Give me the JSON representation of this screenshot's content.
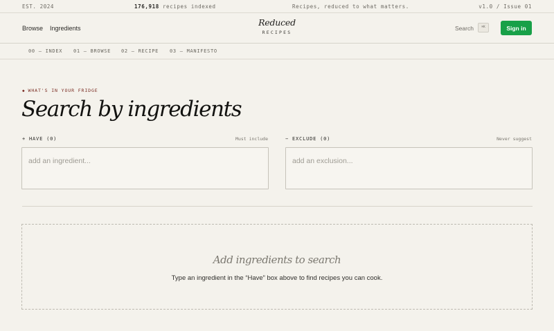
{
  "topstrip": {
    "established": "EST. 2024",
    "count": "176,918",
    "count_suffix": "recipes indexed",
    "tagline": "Recipes, reduced to what matters.",
    "version": "v1.0 / Issue 01"
  },
  "header": {
    "nav": [
      "Browse",
      "Ingredients"
    ],
    "brand_title": "Reduced",
    "brand_sub": "RECIPES",
    "search_label": "Search",
    "search_shortcut": "⌘K",
    "signin_label": "Sign in",
    "accent_color": "#18a048"
  },
  "section_nav": [
    "00 — INDEX",
    "01 — BROWSE",
    "02 — RECIPE",
    "03 — MANIFESTO"
  ],
  "main": {
    "eyebrow": "WHAT'S IN YOUR FRIDGE",
    "eyebrow_marker": "◆",
    "title": "Search by ingredients",
    "have": {
      "label": "+ HAVE (0)",
      "hint": "Must include",
      "value": "",
      "placeholder": "add an ingredient..."
    },
    "exclude": {
      "label": "− EXCLUDE (0)",
      "hint": "Never suggest",
      "value": "",
      "placeholder": "add an exclusion..."
    },
    "empty_state": {
      "title": "Add ingredients to search",
      "subtitle": "Type an ingredient in the “Have” box above to find recipes you can cook."
    }
  }
}
